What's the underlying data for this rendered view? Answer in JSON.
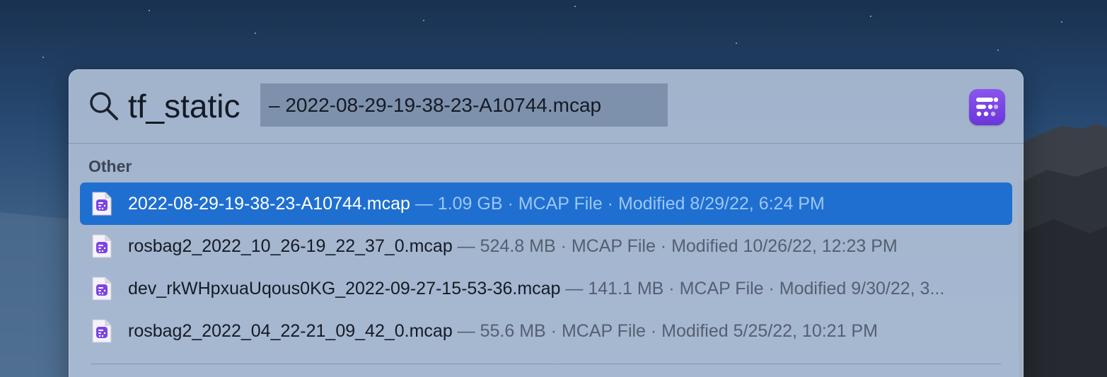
{
  "search": {
    "query": "tf_static",
    "completion": "– 2022-08-29-19-38-23-A10744.mcap",
    "icon": "search-icon"
  },
  "app_badge": {
    "icon": "foxglove-app-icon",
    "color": "#7a45e6"
  },
  "section": {
    "title": "Other"
  },
  "results": [
    {
      "name": "2022-08-29-19-38-23-A10744.mcap",
      "meta": " — 1.09 GB · MCAP File · Modified 8/29/22, 6:24 PM",
      "selected": true,
      "icon": "mcap-file-icon"
    },
    {
      "name": "rosbag2_2022_10_26-19_22_37_0.mcap",
      "meta": " — 524.8 MB · MCAP File · Modified 10/26/22, 12:23 PM",
      "selected": false,
      "icon": "mcap-file-icon"
    },
    {
      "name": "dev_rkWHpxuaUqous0KG_2022-09-27-15-53-36.mcap",
      "meta": " — 141.1 MB · MCAP File · Modified 9/30/22, 3...",
      "selected": false,
      "icon": "mcap-file-icon"
    },
    {
      "name": "rosbag2_2022_04_22-21_09_42_0.mcap",
      "meta": " — 55.6 MB · MCAP File · Modified 5/25/22, 10:21 PM",
      "selected": false,
      "icon": "mcap-file-icon"
    }
  ],
  "colors": {
    "selection": "#1f6fd1",
    "icon_purple": "#7a45e6"
  }
}
